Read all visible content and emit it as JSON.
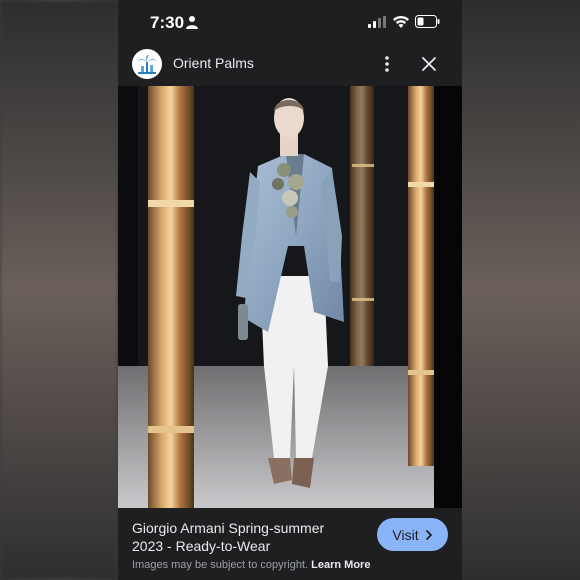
{
  "status_bar": {
    "time": "7:30"
  },
  "header": {
    "site_name": "Orient Palms",
    "logo_icon": "palm-tree-logo",
    "more_icon": "more-vertical-icon",
    "close_icon": "close-icon"
  },
  "image": {
    "subject": "runway-model-photo"
  },
  "caption": {
    "title_line1": "Giorgio Armani Spring-summer",
    "title_line2": "2023 - Ready-to-Wear",
    "visit_label": "Visit",
    "copyright_text": "Images may be subject to copyright.",
    "learn_more_label": "Learn More"
  },
  "colors": {
    "background": "#1f1f21",
    "accent": "#8ab4f8",
    "text": "#e8eaed",
    "muted": "#9aa0a6"
  }
}
